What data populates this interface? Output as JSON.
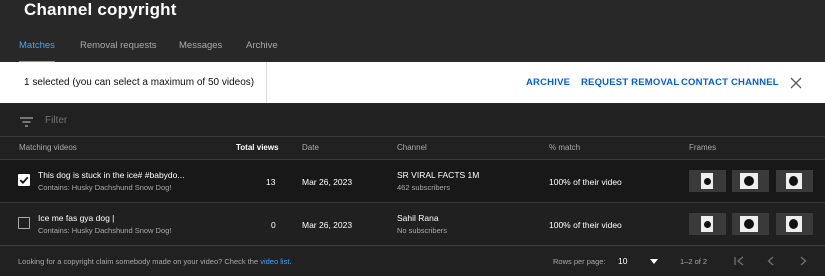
{
  "header": {
    "title": "Channel copyright"
  },
  "tabs": [
    {
      "label": "Matches",
      "active": true
    },
    {
      "label": "Removal requests",
      "active": false
    },
    {
      "label": "Messages",
      "active": false
    },
    {
      "label": "Archive",
      "active": false
    }
  ],
  "selection_bar": {
    "text": "1 selected (you can select a maximum of 50 videos)",
    "archive": "ARCHIVE",
    "request_removal": "REQUEST REMOVAL",
    "contact_channel": "CONTACT CHANNEL",
    "close_icon": "close-icon"
  },
  "filter": {
    "placeholder": "Filter",
    "icon": "filter-icon"
  },
  "table": {
    "columns": {
      "matching_videos": "Matching videos",
      "total_views": "Total views",
      "date": "Date",
      "channel": "Channel",
      "match": "% match",
      "frames": "Frames"
    },
    "rows": [
      {
        "selected": true,
        "title": "This dog is stuck in the ice# #babydo...",
        "contains": "Contains: Husky Dachshund Snow Dog!",
        "views": "13",
        "date": "Mar 26, 2023",
        "channel": "SR VIRAL FACTS 1M",
        "subscribers": "462 subscribers",
        "match": "100% of their video"
      },
      {
        "selected": false,
        "title": "Ice me fas gya dog |",
        "contains": "Contains: Husky Dachshund Snow Dog!",
        "views": "0",
        "date": "Mar 26, 2023",
        "channel": "Sahil Rana",
        "subscribers": "No subscribers",
        "match": "100% of their video"
      }
    ]
  },
  "footer": {
    "text": "Looking for a copyright claim somebody made on your video? Check the ",
    "link": "video list",
    "text_end": ".",
    "rows_per_page_label": "Rows per page:",
    "rows_per_page": "10",
    "range": "1–2 of 2"
  },
  "colors": {
    "accent": "#3ea6ff",
    "action_blue": "#065fd4",
    "background": "#282828"
  }
}
